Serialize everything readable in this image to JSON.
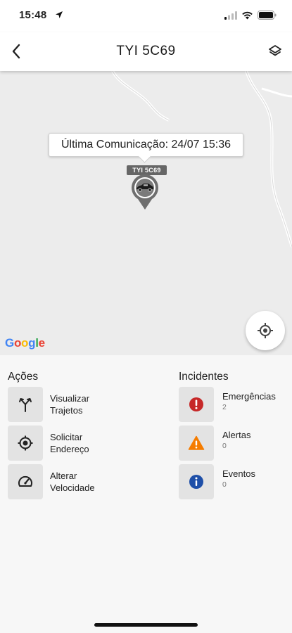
{
  "status_bar": {
    "time": "15:48"
  },
  "header": {
    "title": "TYI 5C69"
  },
  "map": {
    "tooltip": "Última Comunicação: 24/07 15:36",
    "plate_badge": "TYI 5C69",
    "google_logo": [
      "G",
      "o",
      "o",
      "g",
      "l",
      "e"
    ]
  },
  "actions": {
    "title": "Ações",
    "items": [
      {
        "line1": "Visualizar",
        "line2": "Trajetos",
        "icon": "route-split-icon"
      },
      {
        "line1": "Solicitar",
        "line2": "Endereço",
        "icon": "target-icon"
      },
      {
        "line1": "Alterar",
        "line2": "Velocidade",
        "icon": "speedometer-icon"
      }
    ]
  },
  "incidents": {
    "title": "Incidentes",
    "items": [
      {
        "label": "Emergências",
        "count": "2",
        "icon": "emergency-icon",
        "color": "#c62828"
      },
      {
        "label": "Alertas",
        "count": "0",
        "icon": "warning-icon",
        "color": "#f57c00"
      },
      {
        "label": "Eventos",
        "count": "0",
        "icon": "info-icon",
        "color": "#1e4fa8"
      }
    ]
  },
  "colors": {
    "google_blue": "#4285F4",
    "google_red": "#EA4335",
    "google_yellow": "#FBBC05",
    "google_green": "#34A853"
  }
}
